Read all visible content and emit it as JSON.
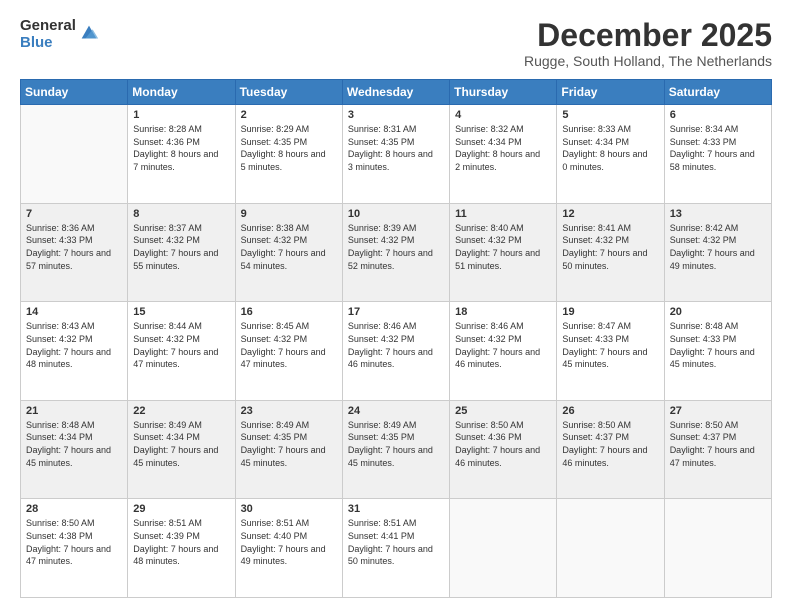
{
  "logo": {
    "general": "General",
    "blue": "Blue"
  },
  "header": {
    "month": "December 2025",
    "location": "Rugge, South Holland, The Netherlands"
  },
  "days_of_week": [
    "Sunday",
    "Monday",
    "Tuesday",
    "Wednesday",
    "Thursday",
    "Friday",
    "Saturday"
  ],
  "weeks": [
    [
      {
        "day": "",
        "sunrise": "",
        "sunset": "",
        "daylight": ""
      },
      {
        "day": "1",
        "sunrise": "Sunrise: 8:28 AM",
        "sunset": "Sunset: 4:36 PM",
        "daylight": "Daylight: 8 hours and 7 minutes."
      },
      {
        "day": "2",
        "sunrise": "Sunrise: 8:29 AM",
        "sunset": "Sunset: 4:35 PM",
        "daylight": "Daylight: 8 hours and 5 minutes."
      },
      {
        "day": "3",
        "sunrise": "Sunrise: 8:31 AM",
        "sunset": "Sunset: 4:35 PM",
        "daylight": "Daylight: 8 hours and 3 minutes."
      },
      {
        "day": "4",
        "sunrise": "Sunrise: 8:32 AM",
        "sunset": "Sunset: 4:34 PM",
        "daylight": "Daylight: 8 hours and 2 minutes."
      },
      {
        "day": "5",
        "sunrise": "Sunrise: 8:33 AM",
        "sunset": "Sunset: 4:34 PM",
        "daylight": "Daylight: 8 hours and 0 minutes."
      },
      {
        "day": "6",
        "sunrise": "Sunrise: 8:34 AM",
        "sunset": "Sunset: 4:33 PM",
        "daylight": "Daylight: 7 hours and 58 minutes."
      }
    ],
    [
      {
        "day": "7",
        "sunrise": "Sunrise: 8:36 AM",
        "sunset": "Sunset: 4:33 PM",
        "daylight": "Daylight: 7 hours and 57 minutes."
      },
      {
        "day": "8",
        "sunrise": "Sunrise: 8:37 AM",
        "sunset": "Sunset: 4:32 PM",
        "daylight": "Daylight: 7 hours and 55 minutes."
      },
      {
        "day": "9",
        "sunrise": "Sunrise: 8:38 AM",
        "sunset": "Sunset: 4:32 PM",
        "daylight": "Daylight: 7 hours and 54 minutes."
      },
      {
        "day": "10",
        "sunrise": "Sunrise: 8:39 AM",
        "sunset": "Sunset: 4:32 PM",
        "daylight": "Daylight: 7 hours and 52 minutes."
      },
      {
        "day": "11",
        "sunrise": "Sunrise: 8:40 AM",
        "sunset": "Sunset: 4:32 PM",
        "daylight": "Daylight: 7 hours and 51 minutes."
      },
      {
        "day": "12",
        "sunrise": "Sunrise: 8:41 AM",
        "sunset": "Sunset: 4:32 PM",
        "daylight": "Daylight: 7 hours and 50 minutes."
      },
      {
        "day": "13",
        "sunrise": "Sunrise: 8:42 AM",
        "sunset": "Sunset: 4:32 PM",
        "daylight": "Daylight: 7 hours and 49 minutes."
      }
    ],
    [
      {
        "day": "14",
        "sunrise": "Sunrise: 8:43 AM",
        "sunset": "Sunset: 4:32 PM",
        "daylight": "Daylight: 7 hours and 48 minutes."
      },
      {
        "day": "15",
        "sunrise": "Sunrise: 8:44 AM",
        "sunset": "Sunset: 4:32 PM",
        "daylight": "Daylight: 7 hours and 47 minutes."
      },
      {
        "day": "16",
        "sunrise": "Sunrise: 8:45 AM",
        "sunset": "Sunset: 4:32 PM",
        "daylight": "Daylight: 7 hours and 47 minutes."
      },
      {
        "day": "17",
        "sunrise": "Sunrise: 8:46 AM",
        "sunset": "Sunset: 4:32 PM",
        "daylight": "Daylight: 7 hours and 46 minutes."
      },
      {
        "day": "18",
        "sunrise": "Sunrise: 8:46 AM",
        "sunset": "Sunset: 4:32 PM",
        "daylight": "Daylight: 7 hours and 46 minutes."
      },
      {
        "day": "19",
        "sunrise": "Sunrise: 8:47 AM",
        "sunset": "Sunset: 4:33 PM",
        "daylight": "Daylight: 7 hours and 45 minutes."
      },
      {
        "day": "20",
        "sunrise": "Sunrise: 8:48 AM",
        "sunset": "Sunset: 4:33 PM",
        "daylight": "Daylight: 7 hours and 45 minutes."
      }
    ],
    [
      {
        "day": "21",
        "sunrise": "Sunrise: 8:48 AM",
        "sunset": "Sunset: 4:34 PM",
        "daylight": "Daylight: 7 hours and 45 minutes."
      },
      {
        "day": "22",
        "sunrise": "Sunrise: 8:49 AM",
        "sunset": "Sunset: 4:34 PM",
        "daylight": "Daylight: 7 hours and 45 minutes."
      },
      {
        "day": "23",
        "sunrise": "Sunrise: 8:49 AM",
        "sunset": "Sunset: 4:35 PM",
        "daylight": "Daylight: 7 hours and 45 minutes."
      },
      {
        "day": "24",
        "sunrise": "Sunrise: 8:49 AM",
        "sunset": "Sunset: 4:35 PM",
        "daylight": "Daylight: 7 hours and 45 minutes."
      },
      {
        "day": "25",
        "sunrise": "Sunrise: 8:50 AM",
        "sunset": "Sunset: 4:36 PM",
        "daylight": "Daylight: 7 hours and 46 minutes."
      },
      {
        "day": "26",
        "sunrise": "Sunrise: 8:50 AM",
        "sunset": "Sunset: 4:37 PM",
        "daylight": "Daylight: 7 hours and 46 minutes."
      },
      {
        "day": "27",
        "sunrise": "Sunrise: 8:50 AM",
        "sunset": "Sunset: 4:37 PM",
        "daylight": "Daylight: 7 hours and 47 minutes."
      }
    ],
    [
      {
        "day": "28",
        "sunrise": "Sunrise: 8:50 AM",
        "sunset": "Sunset: 4:38 PM",
        "daylight": "Daylight: 7 hours and 47 minutes."
      },
      {
        "day": "29",
        "sunrise": "Sunrise: 8:51 AM",
        "sunset": "Sunset: 4:39 PM",
        "daylight": "Daylight: 7 hours and 48 minutes."
      },
      {
        "day": "30",
        "sunrise": "Sunrise: 8:51 AM",
        "sunset": "Sunset: 4:40 PM",
        "daylight": "Daylight: 7 hours and 49 minutes."
      },
      {
        "day": "31",
        "sunrise": "Sunrise: 8:51 AM",
        "sunset": "Sunset: 4:41 PM",
        "daylight": "Daylight: 7 hours and 50 minutes."
      },
      {
        "day": "",
        "sunrise": "",
        "sunset": "",
        "daylight": ""
      },
      {
        "day": "",
        "sunrise": "",
        "sunset": "",
        "daylight": ""
      },
      {
        "day": "",
        "sunrise": "",
        "sunset": "",
        "daylight": ""
      }
    ]
  ]
}
